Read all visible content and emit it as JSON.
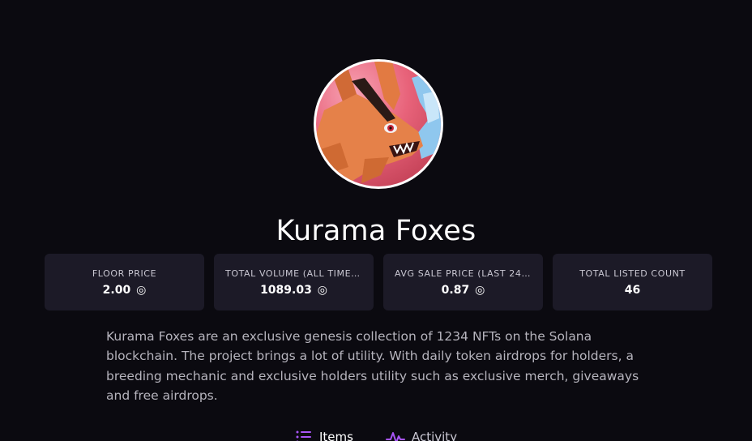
{
  "collection": {
    "name": "Kurama Foxes",
    "description": "Kurama Foxes are an exclusive genesis collection of 1234 NFTs on the Solana blockchain. The project brings a lot of utility. With daily token airdrops for holders, a breeding mechanic and exclusive holders utility such as exclusive merch, giveaways and free airdrops."
  },
  "stats": [
    {
      "label": "FLOOR PRICE",
      "value": "2.00",
      "currency_icon": "solana-icon"
    },
    {
      "label": "TOTAL VOLUME (ALL TIME, SOL)",
      "value": "1089.03",
      "currency_icon": "solana-icon"
    },
    {
      "label": "AVG SALE PRICE (LAST 24HR)",
      "value": "0.87",
      "currency_icon": "solana-icon"
    },
    {
      "label": "TOTAL LISTED COUNT",
      "value": "46"
    }
  ],
  "tabs": [
    {
      "label": "Items",
      "icon": "list-icon"
    },
    {
      "label": "Activity",
      "icon": "activity-icon"
    }
  ],
  "colors": {
    "background": "#0b0a10",
    "card": "#1c1a27",
    "accent": "#a855f7"
  }
}
